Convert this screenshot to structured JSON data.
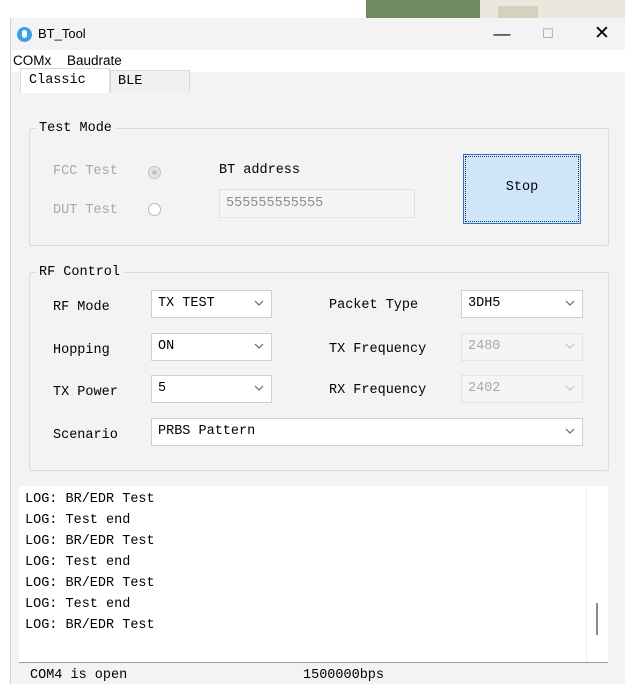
{
  "window": {
    "title": "BT_Tool",
    "controls": {
      "minimize": "—",
      "maximize": "☐",
      "close": "✕"
    }
  },
  "menu": [
    "COMx",
    "Baudrate"
  ],
  "tabs": [
    {
      "label": "Classic",
      "selected": true
    },
    {
      "label": "BLE",
      "selected": false
    }
  ],
  "test_mode": {
    "title": "Test Mode",
    "options": [
      {
        "label": "FCC Test",
        "checked": true,
        "enabled": false
      },
      {
        "label": "DUT Test",
        "checked": false,
        "enabled": false
      }
    ],
    "bt_address_label": "BT address",
    "bt_address_value": "555555555555",
    "stop_label": "Stop"
  },
  "rf_control": {
    "title": "RF Control",
    "rf_mode": {
      "label": "RF Mode",
      "value": "TX TEST"
    },
    "hopping": {
      "label": "Hopping",
      "value": "ON"
    },
    "tx_power": {
      "label": "TX Power",
      "value": "5"
    },
    "packet_type": {
      "label": "Packet Type",
      "value": "3DH5"
    },
    "tx_frequency": {
      "label": "TX Frequency",
      "value": "2480",
      "enabled": false
    },
    "rx_frequency": {
      "label": "RX Frequency",
      "value": "2402",
      "enabled": false
    },
    "scenario": {
      "label": "Scenario",
      "value": "PRBS Pattern"
    }
  },
  "log": [
    "LOG: BR/EDR Test",
    "LOG: Test end",
    "LOG: BR/EDR Test",
    "LOG: Test end",
    "LOG: BR/EDR Test",
    "LOG: Test end",
    "LOG: BR/EDR Test"
  ],
  "status": {
    "port": "COM4 is open",
    "baud": "1500000bps"
  }
}
